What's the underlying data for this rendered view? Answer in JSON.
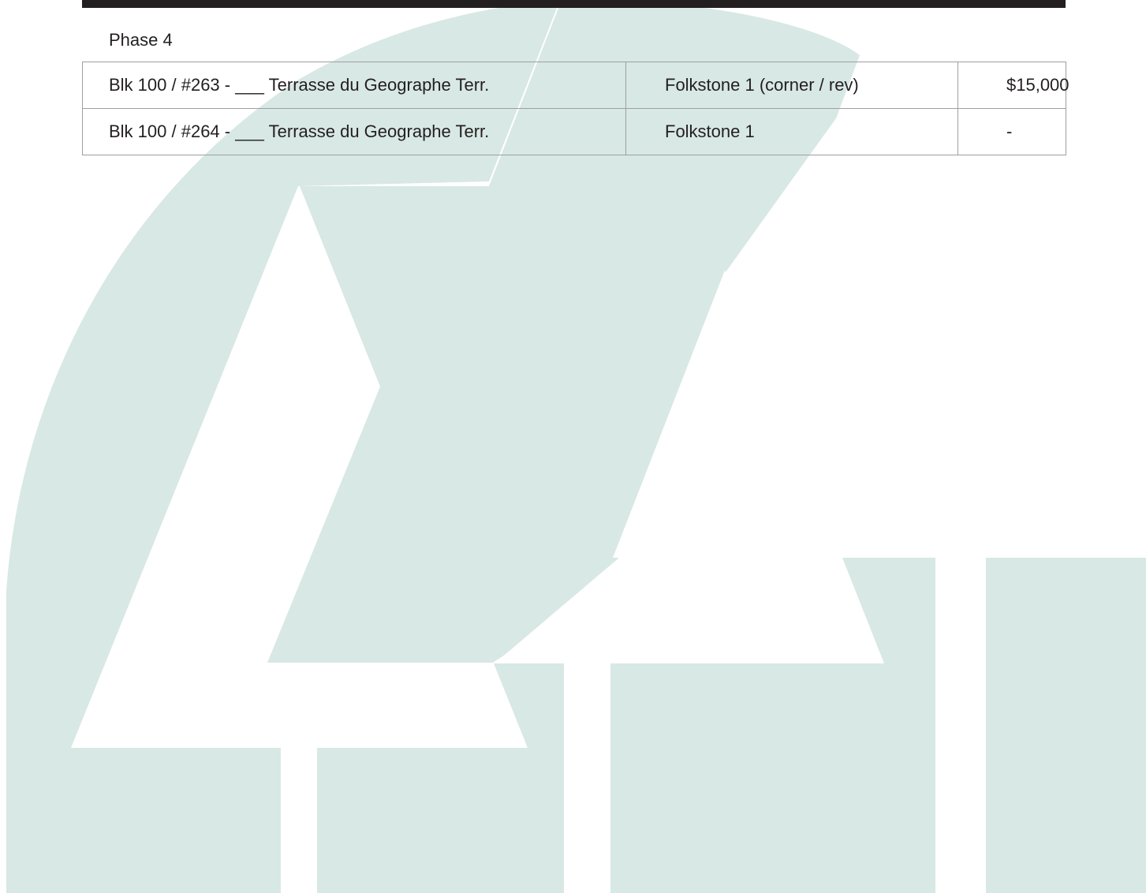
{
  "watermark": {
    "color": "#d8e8e4",
    "icon": "a-logo-watermark"
  },
  "document": {
    "section_title": "Phase 4",
    "rows": [
      {
        "lot": "Blk 100 / #263 - ___ Terrasse du Geographe Terr.",
        "model": "Folkstone 1 (corner / rev)",
        "price": "$15,000"
      },
      {
        "lot": "Blk 100 / #264 - ___ Terrasse du Geographe Terr.",
        "model": "Folkstone 1",
        "price": "-"
      }
    ]
  }
}
